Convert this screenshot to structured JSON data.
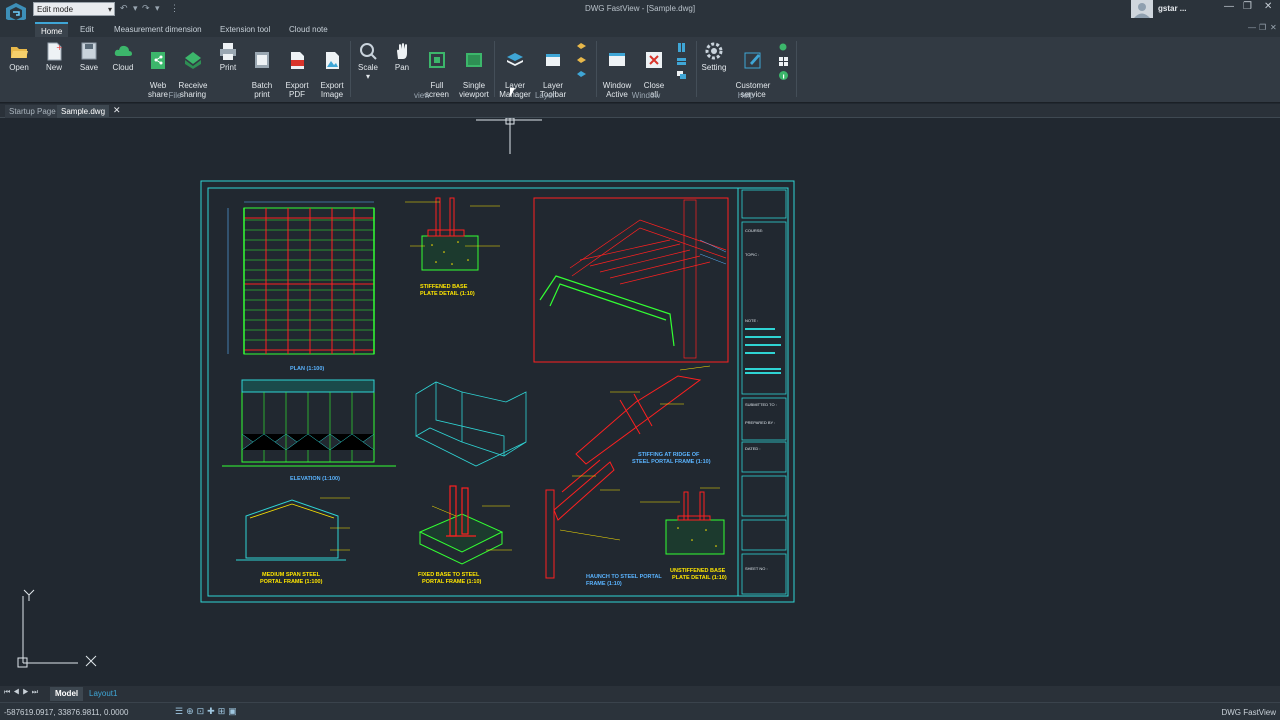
{
  "window": {
    "title": "DWG FastView - [Sample.dwg]",
    "mode": "Edit mode",
    "user": "gstar ..."
  },
  "menu": {
    "tabs": [
      "Home",
      "Edit",
      "Measurement dimension",
      "Extension tool",
      "Cloud note"
    ],
    "active": "Home"
  },
  "ribbon": {
    "buttons": [
      "Open",
      "New",
      "Save",
      "Cloud",
      "Web\nshare",
      "Receive\nsharing",
      "Print",
      "Batch\nprint",
      "Export\nPDF",
      "Export\nImage",
      "Scale",
      "Pan",
      "Full\nscreen",
      "Single\nviewport",
      "Layer\nManager",
      "Layer\nToolbar",
      "Window\nActive",
      "Close\nall",
      "Setting",
      "Customer\nservice"
    ],
    "groups": {
      "file": "File",
      "view": "view",
      "layer": "Layer",
      "window": "Window",
      "help": "Help"
    }
  },
  "doc_tabs": [
    "Startup Page",
    "Sample.dwg"
  ],
  "layout_tabs": [
    "Model",
    "Layout1"
  ],
  "status": {
    "coords": "-587619.0917, 33876.9811, 0.0000",
    "brand": "DWG FastView"
  },
  "drawing": {
    "labels": {
      "plan": "PLAN (1:100)",
      "elevation": "ELEVATION (1:100)",
      "stiffened": "STIFFENED BASE\nPLATE DETAIL (1:10)",
      "fixed_base": "FIXED BASE TO STEEL\nPORTAL FRAME (1:10)",
      "haunch": "HAUNCH TO STEEL PORTAL\nFRAME (1:10)",
      "unstiffened": "UNSTIFFENED BASE\nPLATE DETAIL (1:10)",
      "medium_span": "MEDIUM SPAN STEEL\nPORTAL FRAME (1:100)",
      "stiffing": "STIFFING AT RIDGE OF\nSTEEL PORTAL FRAME (1:10)"
    },
    "title_block": {
      "course": "COURSE:",
      "topic": "TOPIC :",
      "note": "NOTE :",
      "submitted_to": "SUBMITTED TO :",
      "prepared_by": "PREPARED BY :",
      "dated": "DATED :",
      "sheet_no": "SHEET NO :"
    }
  },
  "colors": {
    "accent": "#3fa6d6",
    "frame": "#2fd4d4",
    "cad_green": "#33ff33",
    "cad_red": "#ff2020",
    "cad_yellow": "#ffe600"
  }
}
